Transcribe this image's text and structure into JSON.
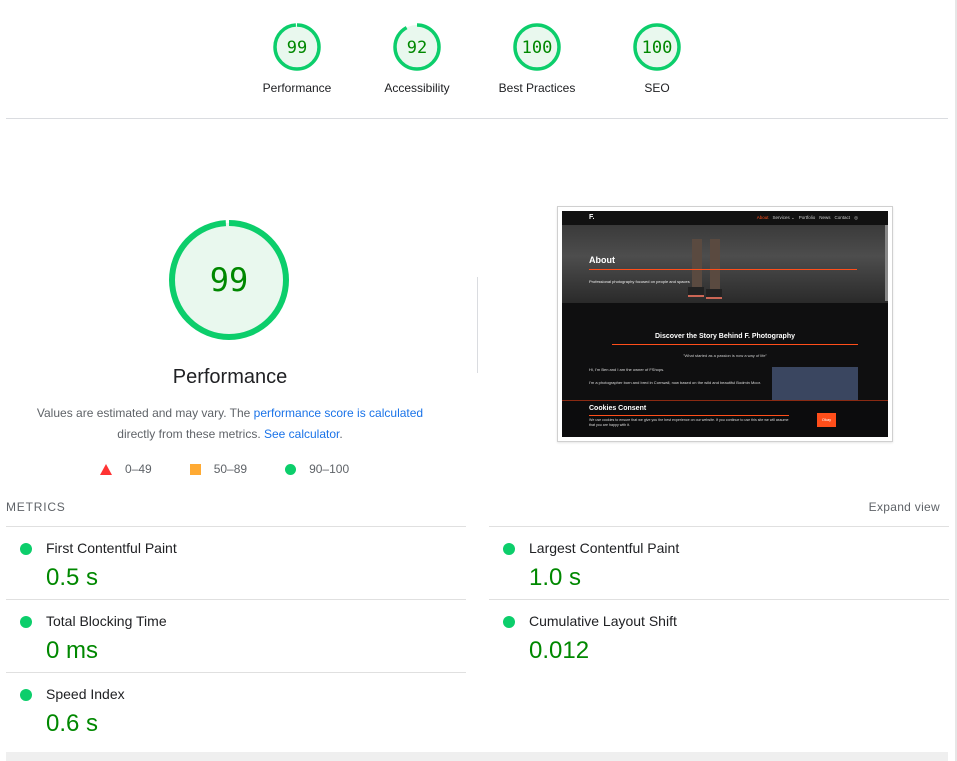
{
  "colors": {
    "pass_green": "#0cce6b",
    "value_green": "#008800",
    "fail_red": "#ff3333",
    "average_orange": "#ffaa33",
    "link_blue": "#1a73e8"
  },
  "top_scores": [
    {
      "score": "99",
      "fraction": 0.99,
      "label": "Performance"
    },
    {
      "score": "92",
      "fraction": 0.92,
      "label": "Accessibility"
    },
    {
      "score": "100",
      "fraction": 1.0,
      "label": "Best Practices"
    },
    {
      "score": "100",
      "fraction": 1.0,
      "label": "SEO"
    }
  ],
  "performance": {
    "score": "99",
    "fraction": 0.99,
    "title": "Performance",
    "desc_part1": "Values are estimated and may vary. The ",
    "desc_link1": "performance score is calculated",
    "desc_part2": " directly from these metrics. ",
    "desc_link2": "See calculator",
    "desc_part3": "."
  },
  "legend": {
    "fail": "0–49",
    "average": "50–89",
    "pass": "90–100"
  },
  "thumbnail": {
    "logo": "F.",
    "nav": [
      "About",
      "Services ⌄",
      "Portfolio",
      "News",
      "Contact",
      "◎"
    ],
    "hero_title": "About",
    "hero_sub": "Professional photography focused on people and spaces",
    "story_title": "Discover the Story Behind F. Photography",
    "quote": "\"What started as a passion is now a way of life\"",
    "para1": "Hi, I'm Ben and I am the owner of FShops.",
    "para2": "I'm a photographer born and bred in Cornwall, now based on the wild and beautiful Bodmin Moor.",
    "cookie_title": "Cookies Consent",
    "cookie_text": "We use cookies to ensure that we give you the best experience on our website. If you continue to use this site we will assume that you are happy with it.",
    "cookie_button": "Okay"
  },
  "metrics": {
    "heading": "METRICS",
    "expand_label": "Expand view",
    "items": [
      {
        "title": "First Contentful Paint",
        "value": "0.5 s"
      },
      {
        "title": "Largest Contentful Paint",
        "value": "1.0 s"
      },
      {
        "title": "Total Blocking Time",
        "value": "0 ms"
      },
      {
        "title": "Cumulative Layout Shift",
        "value": "0.012"
      },
      {
        "title": "Speed Index",
        "value": "0.6 s"
      }
    ]
  }
}
